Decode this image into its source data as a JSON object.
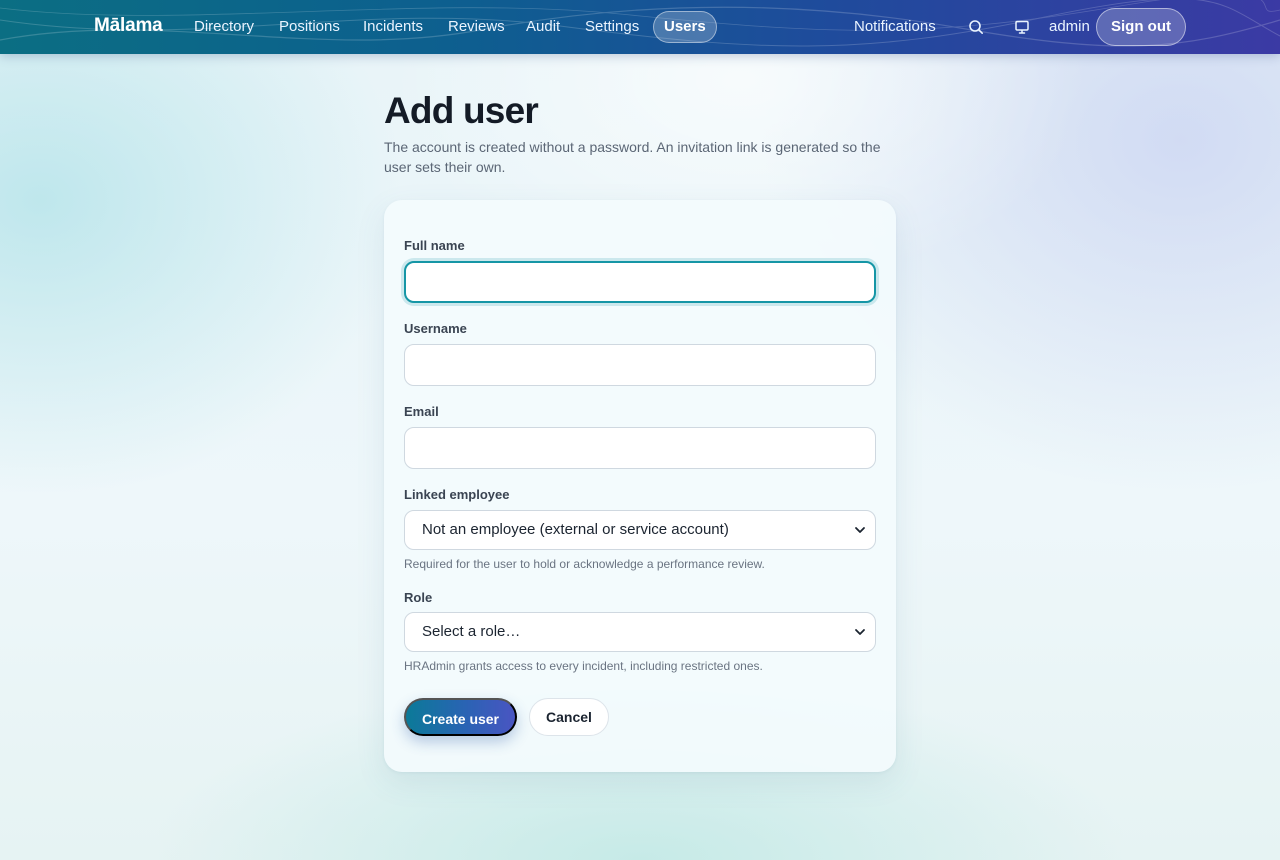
{
  "nav": {
    "brand": "Mālama",
    "items": [
      {
        "label": "Directory",
        "active": false
      },
      {
        "label": "Positions",
        "active": false
      },
      {
        "label": "Incidents",
        "active": false
      },
      {
        "label": "Reviews",
        "active": false
      },
      {
        "label": "Audit",
        "active": false
      },
      {
        "label": "Settings",
        "active": false
      },
      {
        "label": "Users",
        "active": true
      }
    ],
    "notifications_label": "Notifications",
    "search_icon": "search-icon",
    "display_icon": "monitor-icon",
    "username": "admin",
    "signout_label": "Sign out"
  },
  "page": {
    "title": "Add user",
    "description": "The account is created without a password. An invitation link is generated so the user sets their own."
  },
  "form": {
    "full_name": {
      "label": "Full name",
      "value": ""
    },
    "username": {
      "label": "Username",
      "value": ""
    },
    "email": {
      "label": "Email",
      "value": ""
    },
    "linked_employee": {
      "label": "Linked employee",
      "selected": "Not an employee (external or service account)",
      "help": "Required for the user to hold or acknowledge a performance review."
    },
    "role": {
      "label": "Role",
      "selected": "Select a role…",
      "help": "HRAdmin grants access to every incident, including restricted ones."
    },
    "submit_label": "Create user",
    "cancel_label": "Cancel"
  },
  "colors": {
    "accent": "#1596a6",
    "nav_gradient_start": "#0b6e83",
    "nav_gradient_end": "#3b3aa4"
  }
}
